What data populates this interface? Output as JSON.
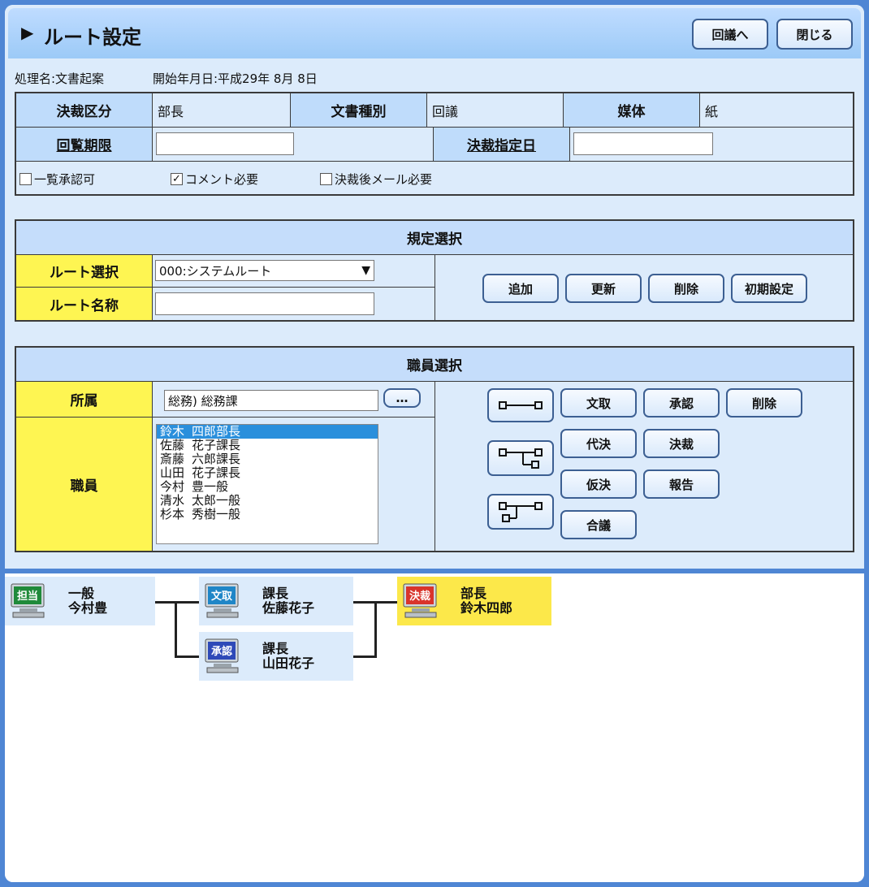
{
  "window": {
    "title": "ルート設定"
  },
  "header_buttons": {
    "circulate": "回議へ",
    "close": "閉じる"
  },
  "info": {
    "process_label": "処理名:文書起案",
    "start_date_label": "開始年月日:平成29年 8月 8日"
  },
  "doc_table": {
    "decision_type_label": "決裁区分",
    "decision_type_value": "部長",
    "doc_type_label": "文書種別",
    "doc_type_value": "回議",
    "medium_label": "媒体",
    "medium_value": "紙",
    "review_deadline_label": "回覧期限",
    "review_deadline_value": "",
    "decision_date_label": "決裁指定日",
    "decision_date_value": "",
    "checkboxes": [
      {
        "label": "一覧承認可",
        "checked": false
      },
      {
        "label": "コメント必要",
        "checked": true
      },
      {
        "label": "決裁後メール必要",
        "checked": false
      }
    ]
  },
  "preset": {
    "header": "規定選択",
    "route_select_label": "ルート選択",
    "route_select_value": "000:システムルート",
    "route_name_label": "ルート名称",
    "route_name_value": "",
    "buttons": {
      "add": "追加",
      "update": "更新",
      "delete": "削除",
      "reset": "初期設定"
    }
  },
  "staff": {
    "header": "職員選択",
    "dept_label": "所属",
    "dept_value": "総務) 総務課",
    "more_button": "…",
    "staff_label": "職員",
    "members": [
      "鈴木 四郎部長",
      "佐藤 花子課長",
      "斎藤 六郎課長",
      "山田 花子課長",
      "今村 豊一般",
      "清水 太郎一般",
      "杉本 秀樹一般"
    ],
    "selected_index": 0,
    "buttons": {
      "receive": "文取",
      "approve": "承認",
      "delete": "削除",
      "proxy": "代決",
      "decide": "決裁",
      "provisional": "仮決",
      "report": "報告",
      "consult": "合議"
    }
  },
  "route": {
    "nodes": [
      {
        "badge": "担当",
        "role": "一般",
        "name": "今村豊",
        "badge_color": "#1f8a3a"
      },
      {
        "badge": "文取",
        "role": "課長",
        "name": "佐藤花子",
        "badge_color": "#1f86c7"
      },
      {
        "badge": "承認",
        "role": "課長",
        "name": "山田花子",
        "badge_color": "#2e49b8"
      },
      {
        "badge": "決裁",
        "role": "部長",
        "name": "鈴木四郎",
        "badge_color": "#d9342b"
      }
    ]
  }
}
